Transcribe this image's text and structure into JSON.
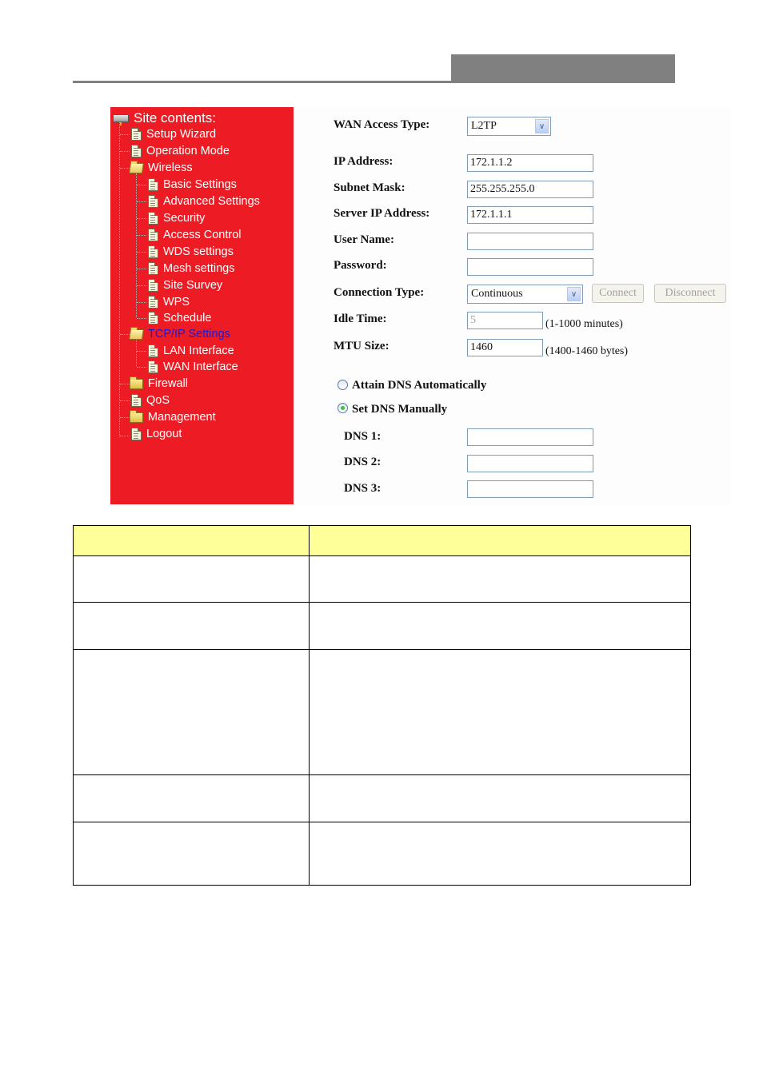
{
  "header": {
    "decor": "header-rule"
  },
  "sidebar": {
    "title": "Site contents:",
    "items": [
      {
        "label": "Setup Wizard",
        "icon": "document-icon",
        "level": 1
      },
      {
        "label": "Operation Mode",
        "icon": "document-icon",
        "level": 1
      },
      {
        "label": "Wireless",
        "icon": "folder-open-icon",
        "level": 1
      },
      {
        "label": "Basic Settings",
        "icon": "document-icon",
        "level": 2
      },
      {
        "label": "Advanced Settings",
        "icon": "document-icon",
        "level": 2
      },
      {
        "label": "Security",
        "icon": "document-icon",
        "level": 2
      },
      {
        "label": "Access Control",
        "icon": "document-icon",
        "level": 2
      },
      {
        "label": "WDS settings",
        "icon": "document-icon",
        "level": 2
      },
      {
        "label": "Mesh settings",
        "icon": "document-icon",
        "level": 2
      },
      {
        "label": "Site Survey",
        "icon": "document-icon",
        "level": 2
      },
      {
        "label": "WPS",
        "icon": "document-icon",
        "level": 2
      },
      {
        "label": "Schedule",
        "icon": "document-icon",
        "level": 2
      },
      {
        "label": "TCP/IP Settings",
        "icon": "folder-open-icon",
        "level": 1,
        "active": true
      },
      {
        "label": "LAN Interface",
        "icon": "document-icon",
        "level": 2
      },
      {
        "label": "WAN Interface",
        "icon": "document-icon",
        "level": 2
      },
      {
        "label": "Firewall",
        "icon": "folder-icon",
        "level": 1
      },
      {
        "label": "QoS",
        "icon": "document-icon",
        "level": 1
      },
      {
        "label": "Management",
        "icon": "folder-icon",
        "level": 1
      },
      {
        "label": "Logout",
        "icon": "document-icon",
        "level": 1
      }
    ],
    "colors": {
      "background": "#ed1c24",
      "text": "#ffffff",
      "active": "#1b1bd6"
    }
  },
  "form": {
    "wan_access_type": {
      "label": "WAN Access Type:",
      "value": "L2TP"
    },
    "ip_address": {
      "label": "IP Address:",
      "value": "172.1.1.2"
    },
    "subnet_mask": {
      "label": "Subnet Mask:",
      "value": "255.255.255.0"
    },
    "server_ip": {
      "label": "Server IP Address:",
      "value": "172.1.1.1"
    },
    "user_name": {
      "label": "User Name:",
      "value": ""
    },
    "password": {
      "label": "Password:",
      "value": ""
    },
    "connection_type": {
      "label": "Connection Type:",
      "value": "Continuous"
    },
    "connect_button": "Connect",
    "disconnect_button": "Disconnect",
    "idle_time": {
      "label": "Idle Time:",
      "value": "5",
      "hint": "(1-1000 minutes)"
    },
    "mtu_size": {
      "label": "MTU Size:",
      "value": "1460",
      "hint": "(1400-1460 bytes)"
    },
    "dns_auto": {
      "label": "Attain DNS Automatically",
      "checked": false
    },
    "dns_manual": {
      "label": "Set DNS Manually",
      "checked": true
    },
    "dns1": {
      "label": "DNS 1:",
      "value": ""
    },
    "dns2": {
      "label": "DNS 2:",
      "value": ""
    },
    "dns3": {
      "label": "DNS 3:",
      "value": ""
    }
  },
  "table": {
    "header_color": "#ffff99",
    "header": [
      "",
      ""
    ],
    "rows": [
      [
        "",
        ""
      ],
      [
        "",
        ""
      ],
      [
        "",
        ""
      ],
      [
        "",
        ""
      ],
      [
        "",
        ""
      ]
    ]
  }
}
